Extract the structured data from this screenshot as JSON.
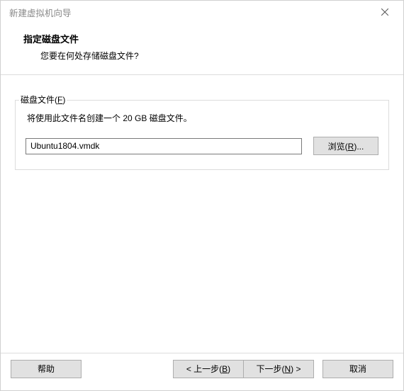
{
  "window": {
    "title": "新建虚拟机向导"
  },
  "header": {
    "title": "指定磁盘文件",
    "subtitle": "您要在何处存储磁盘文件?"
  },
  "group": {
    "label_plain": "磁盘文件(",
    "label_hotkey": "F",
    "label_close": ")",
    "description": "将使用此文件名创建一个 20 GB 磁盘文件。",
    "input_value": "Ubuntu1804.vmdk",
    "browse_plain": "浏览(",
    "browse_hotkey": "R",
    "browse_close": ")..."
  },
  "footer": {
    "help": "帮助",
    "back_prefix": "< 上一步(",
    "back_hotkey": "B",
    "back_suffix": ")",
    "next_prefix": "下一步(",
    "next_hotkey": "N",
    "next_suffix": ") >",
    "cancel": "取消"
  }
}
